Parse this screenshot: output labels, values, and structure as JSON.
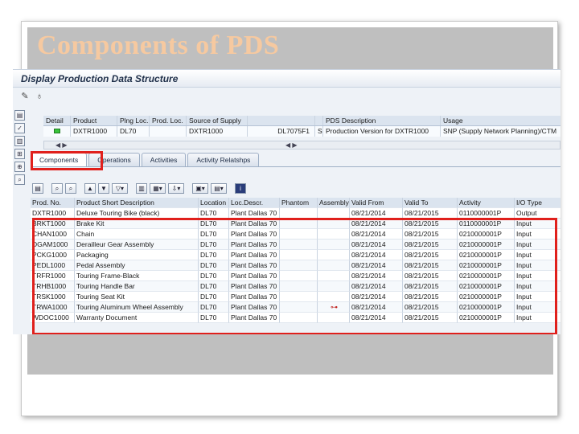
{
  "slide": {
    "title": "Components of PDS"
  },
  "window": {
    "title": "Display Production Data Structure"
  },
  "toolbar_icons": [
    "pencil-icon",
    "glasses-icon"
  ],
  "sidebar_icons": [
    "header-icon",
    "check-icon",
    "print-icon",
    "tree-icon",
    "where-used-icon",
    "search-icon"
  ],
  "header_grid": {
    "columns": [
      "Detail",
      "Product",
      "Plng Loc.",
      "Prod. Loc.",
      "Source of Supply",
      "",
      "",
      "PDS Description",
      "Usage"
    ],
    "row": [
      "",
      "DXTR1000",
      "DL70",
      "",
      "DXTR1000",
      "DL7075F1",
      "S",
      "Production Version for DXTR1000",
      "SNP (Supply Network Planning)/CTM"
    ]
  },
  "scrollbar": {
    "left": "◀ ▶",
    "right": "◀ ▶"
  },
  "tabs": [
    {
      "label": "Components",
      "active": true
    },
    {
      "label": "Operations",
      "active": false
    },
    {
      "label": "Activities",
      "active": false
    },
    {
      "label": "Activity Relatshps",
      "active": false
    }
  ],
  "components": {
    "columns": [
      "Prod. No.",
      "Product Short Description",
      "Location",
      "Loc.Descr.",
      "Phantom",
      "Assembly",
      "Valid From",
      "Valid To",
      "Activity",
      "I/O Type"
    ],
    "rows": [
      [
        "DXTR1000",
        "Deluxe Touring Bike (black)",
        "DL70",
        "Plant Dallas 70",
        "",
        "",
        "08/21/2014",
        "08/21/2015",
        "0110000001P",
        "Output"
      ],
      [
        "BRKT1000",
        "Brake Kit",
        "DL70",
        "Plant Dallas 70",
        "",
        "",
        "08/21/2014",
        "08/21/2015",
        "0110000001P",
        "Input"
      ],
      [
        "CHAN1000",
        "Chain",
        "DL70",
        "Plant Dallas 70",
        "",
        "",
        "08/21/2014",
        "08/21/2015",
        "0210000001P",
        "Input"
      ],
      [
        "DGAM1000",
        "Derailleur Gear Assembly",
        "DL70",
        "Plant Dallas 70",
        "",
        "",
        "08/21/2014",
        "08/21/2015",
        "0210000001P",
        "Input"
      ],
      [
        "PCKG1000",
        "Packaging",
        "DL70",
        "Plant Dallas 70",
        "",
        "",
        "08/21/2014",
        "08/21/2015",
        "0210000001P",
        "Input"
      ],
      [
        "PEDL1000",
        "Pedal Assembly",
        "DL70",
        "Plant Dallas 70",
        "",
        "",
        "08/21/2014",
        "08/21/2015",
        "0210000001P",
        "Input"
      ],
      [
        "TRFR1000",
        "Touring Frame-Black",
        "DL70",
        "Plant Dallas 70",
        "",
        "",
        "08/21/2014",
        "08/21/2015",
        "0210000001P",
        "Input"
      ],
      [
        "TRHB1000",
        "Touring Handle Bar",
        "DL70",
        "Plant Dallas 70",
        "",
        "",
        "08/21/2014",
        "08/21/2015",
        "0210000001P",
        "Input"
      ],
      [
        "TRSK1000",
        "Touring Seat Kit",
        "DL70",
        "Plant Dallas 70",
        "",
        "",
        "08/21/2014",
        "08/21/2015",
        "0210000001P",
        "Input"
      ],
      [
        "TRWA1000",
        "Touring Aluminum Wheel Assembly",
        "DL70",
        "Plant Dallas 70",
        "",
        "",
        "08/21/2014",
        "08/21/2015",
        "0210000001P",
        "Input"
      ],
      [
        "WDOC1000",
        "Warranty Document",
        "DL70",
        "Plant Dallas 70",
        "",
        "",
        "08/21/2014",
        "08/21/2015",
        "0210000001P",
        "Input"
      ]
    ]
  },
  "colors": {
    "highlight": "#e0201c",
    "title": "#f6c9a0",
    "panel": "#bfbfbf"
  }
}
